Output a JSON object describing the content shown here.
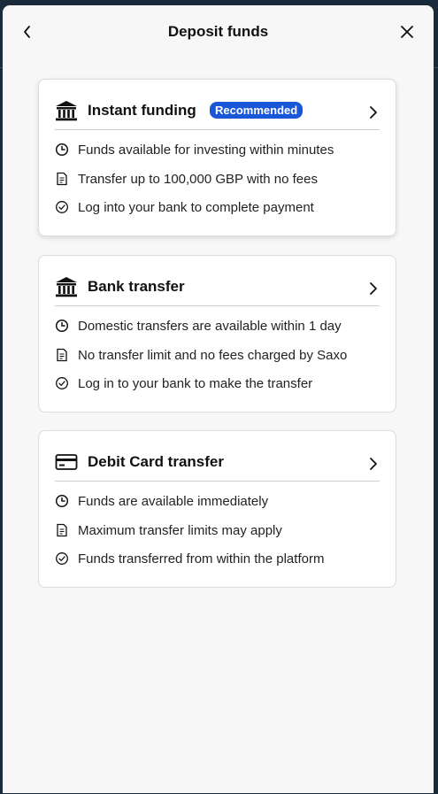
{
  "header": {
    "title": "Deposit funds",
    "back_icon": "chevron-left-icon",
    "close_icon": "close-icon"
  },
  "colors": {
    "badge": "#1857d8",
    "text": "#111111"
  },
  "options": [
    {
      "title": "Instant funding",
      "badge": "Recommended",
      "icon": "bank-icon",
      "features": [
        {
          "icon": "clock-icon",
          "text": "Funds available for investing within minutes"
        },
        {
          "icon": "document-icon",
          "text": "Transfer up to 100,000 GBP with no fees"
        },
        {
          "icon": "check-circle-icon",
          "text": "Log into your bank to complete payment"
        }
      ]
    },
    {
      "title": "Bank transfer",
      "icon": "bank-icon",
      "features": [
        {
          "icon": "clock-icon",
          "text": "Domestic transfers are available within 1 day"
        },
        {
          "icon": "document-icon",
          "text": "No transfer limit and no fees charged by Saxo"
        },
        {
          "icon": "check-circle-icon",
          "text": "Log in to your bank to make the transfer"
        }
      ]
    },
    {
      "title": "Debit Card transfer",
      "icon": "credit-card-icon",
      "features": [
        {
          "icon": "clock-icon",
          "text": "Funds are available immediately"
        },
        {
          "icon": "document-icon",
          "text": "Maximum transfer limits may apply"
        },
        {
          "icon": "check-circle-icon",
          "text": "Funds transferred from within the platform"
        }
      ]
    }
  ]
}
